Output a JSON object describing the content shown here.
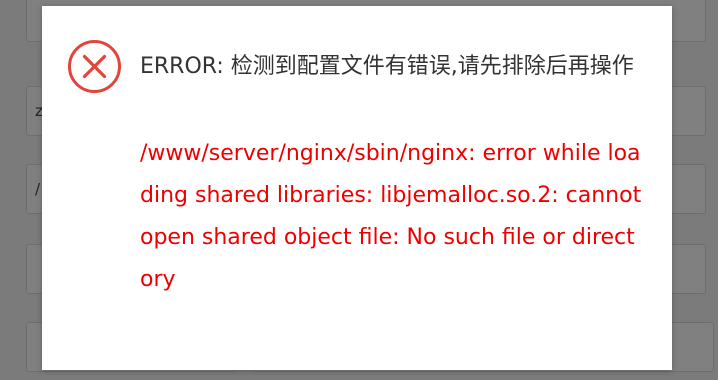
{
  "background": {
    "fields": [
      "",
      "z",
      "/",
      "",
      "",
      ""
    ]
  },
  "dialog": {
    "icon": "error-circle-x-icon",
    "title": "ERROR: 检测到配置文件有错误,请先排除后再操作",
    "message": "/www/server/nginx/sbin/nginx: error while loading shared libraries: libjemalloc.so.2: cannot open shared object file: No such file or directory",
    "colors": {
      "icon": "#e0463c",
      "message": "#ee0000",
      "title": "#333333"
    }
  }
}
